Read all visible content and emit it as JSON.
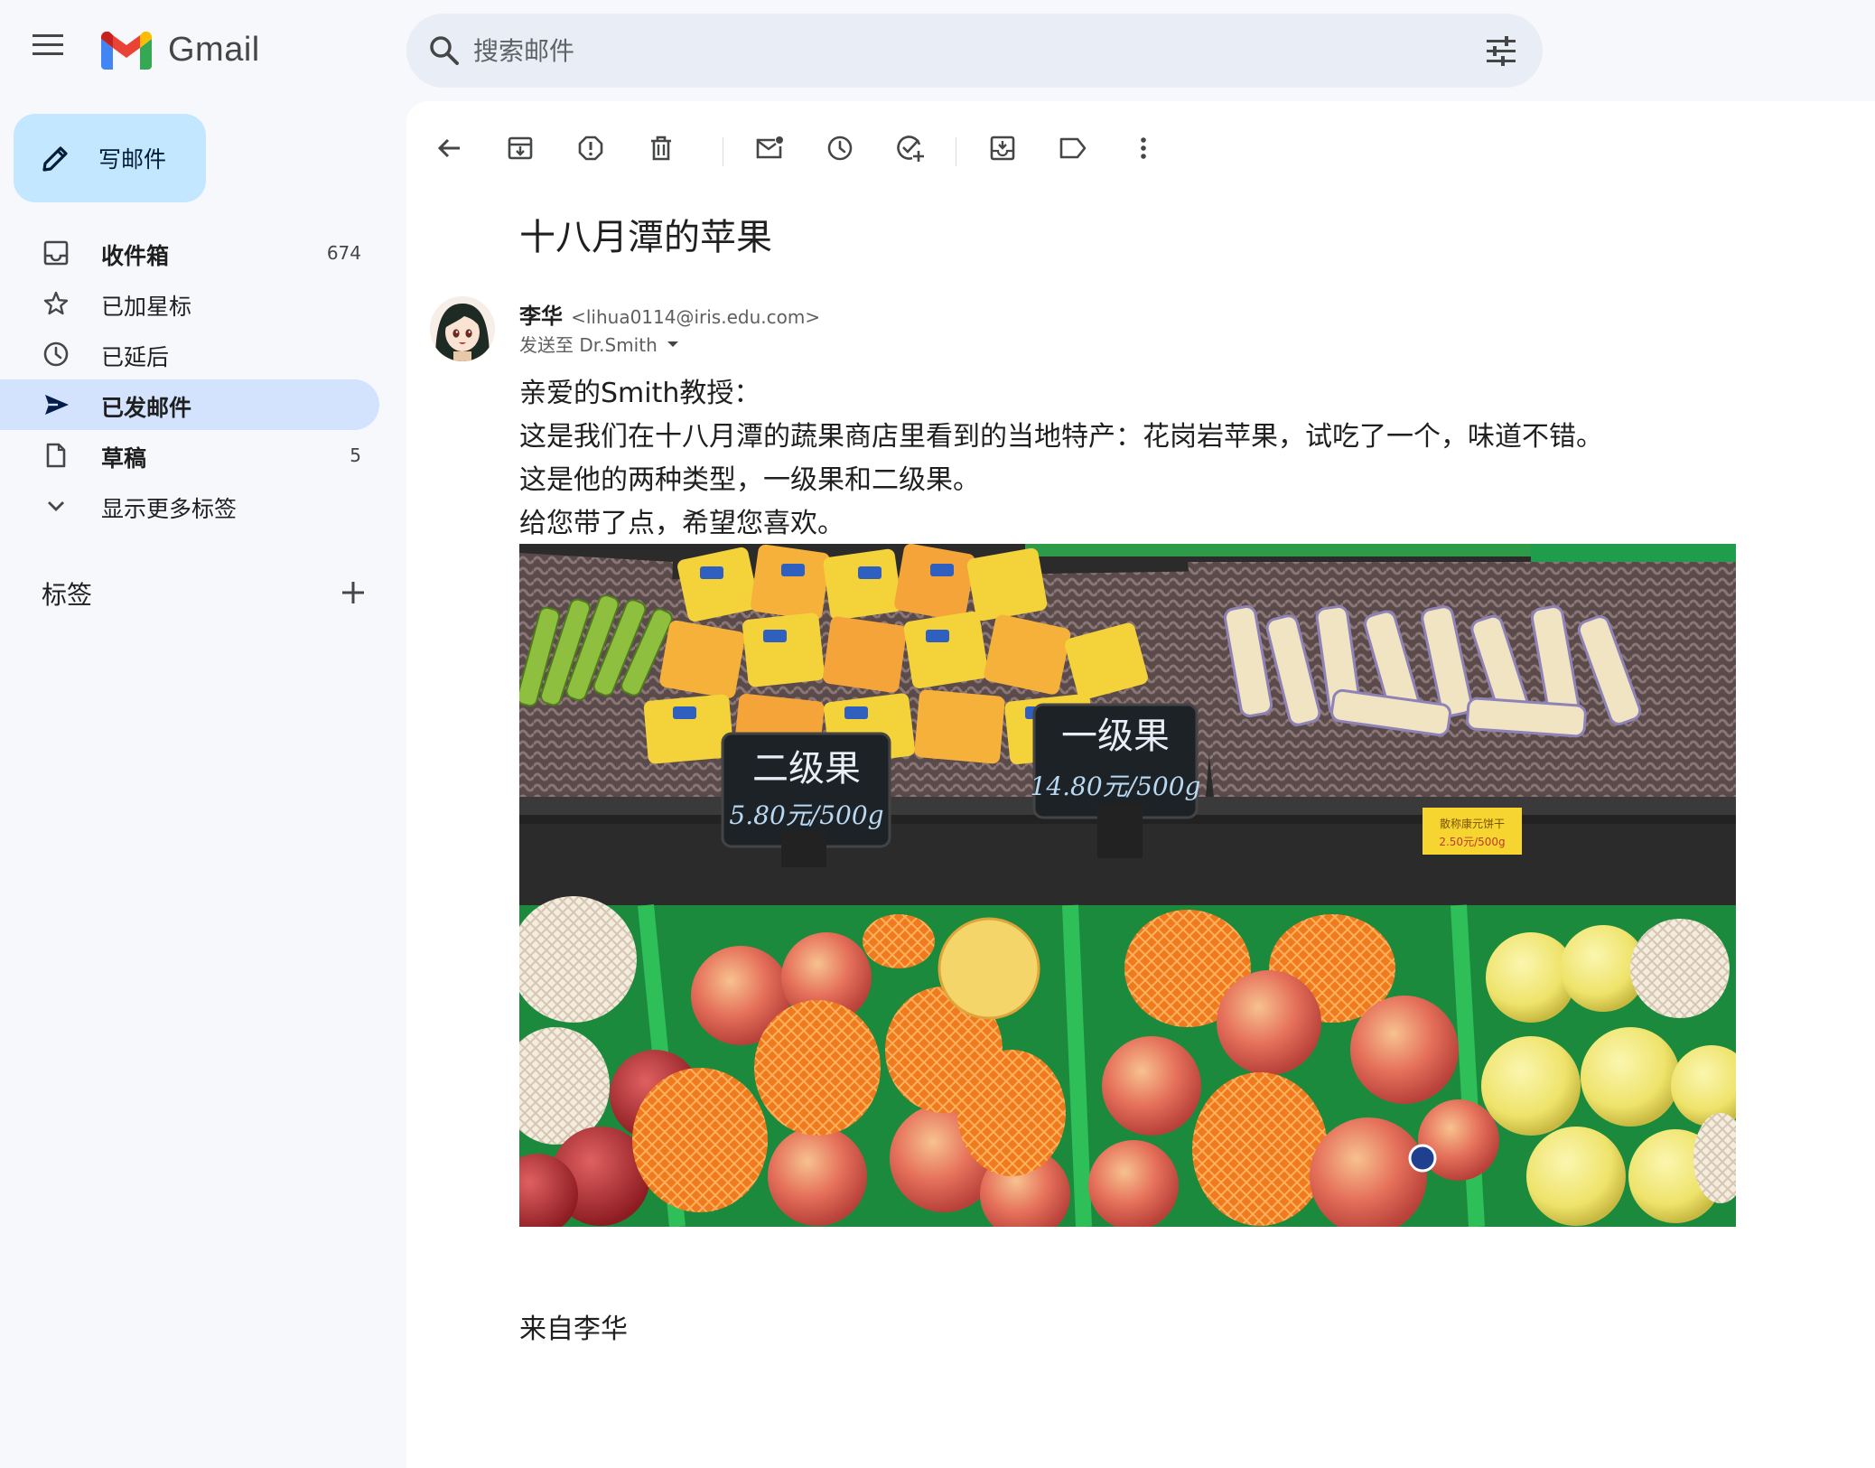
{
  "app": {
    "name": "Gmail"
  },
  "search": {
    "placeholder": "搜索邮件"
  },
  "compose": {
    "label": "写邮件"
  },
  "sidebar": {
    "items": [
      {
        "label": "收件箱",
        "count": "674",
        "icon": "inbox-icon",
        "bold": true
      },
      {
        "label": "已加星标",
        "count": "",
        "icon": "star-icon",
        "bold": false
      },
      {
        "label": "已延后",
        "count": "",
        "icon": "clock-icon",
        "bold": false
      },
      {
        "label": "已发邮件",
        "count": "",
        "icon": "send-icon",
        "bold": true,
        "active": true
      },
      {
        "label": "草稿",
        "count": "5",
        "icon": "draft-icon",
        "bold": true
      },
      {
        "label": "显示更多标签",
        "count": "",
        "icon": "chevron-down-icon",
        "bold": false
      }
    ],
    "labels_title": "标签"
  },
  "toolbar": {
    "icons": [
      "back-arrow-icon",
      "archive-icon",
      "report-spam-icon",
      "delete-icon",
      "mark-unread-icon",
      "snooze-icon",
      "add-task-icon",
      "move-to-icon",
      "label-icon",
      "more-icon"
    ]
  },
  "email": {
    "subject": "十八月潭的苹果",
    "sender_name": "李华",
    "sender_email": "<lihua0114@iris.edu.com>",
    "recipient": "发送至 Dr.Smith",
    "body": [
      "亲爱的Smith教授：",
      "这是我们在十八月潭的蔬果商店里看到的当地特产：花岗岩苹果，试吃了一个，味道不错。",
      "这是他的两种类型，一级果和二级果。",
      "给您带了点，希望您喜欢。"
    ],
    "photo": {
      "sign_left": "二级果",
      "price_left": "5.80元/500g",
      "sign_right": "一级果",
      "price_right": "14.80元/500g",
      "tag_title": "散称康元饼干",
      "tag_price": "2.50元/500g"
    },
    "signature": "来自李华"
  },
  "colors": {
    "accent": "#0b57d0",
    "compose_bg": "#c2e7ff",
    "active_nav": "#d3e3fd",
    "search_bg": "#e9eef6"
  }
}
